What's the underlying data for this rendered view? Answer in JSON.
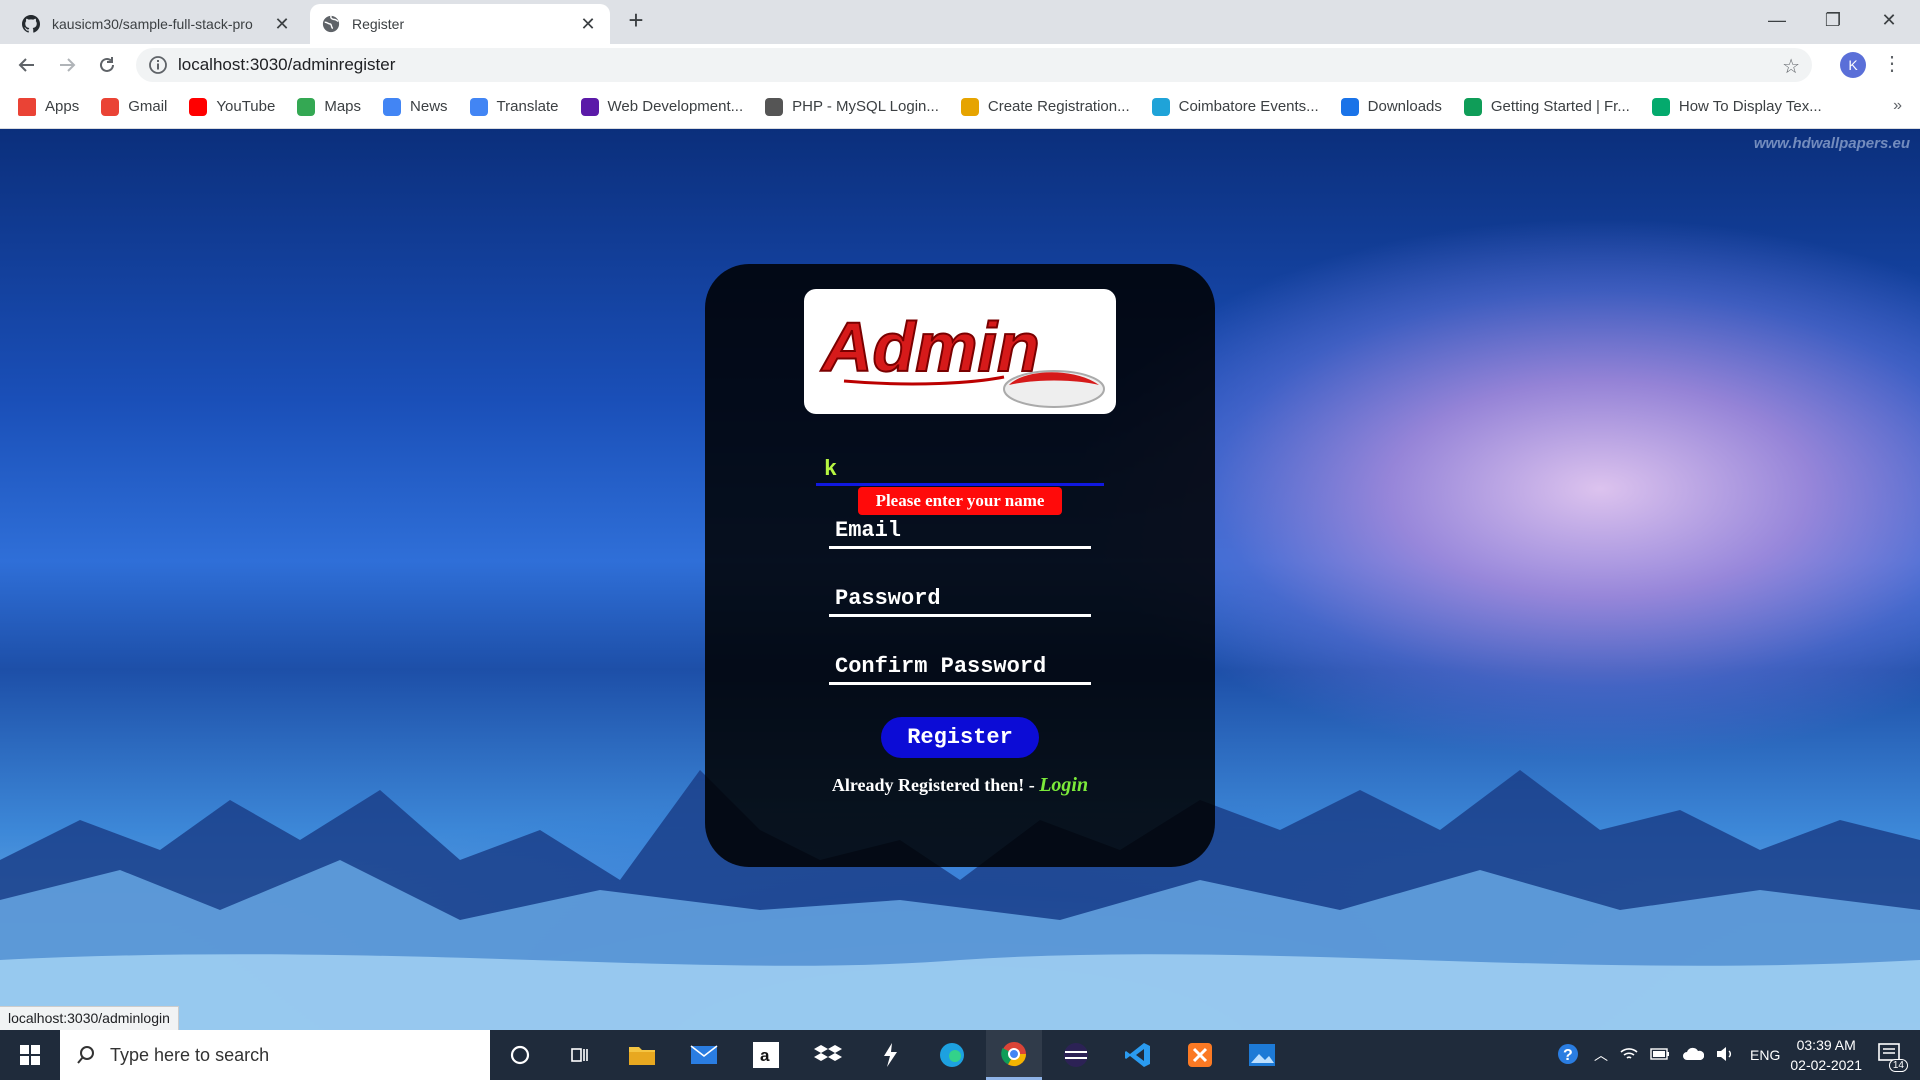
{
  "browser": {
    "tabs": [
      {
        "title": "kausicm30/sample-full-stack-pro",
        "favicon": "github-icon",
        "active": false
      },
      {
        "title": "Register",
        "favicon": "globe-icon",
        "active": true
      }
    ],
    "url_host": "localhost:3030",
    "url_path": "/adminregister",
    "profile_initial": "K"
  },
  "bookmarks": [
    {
      "label": "Apps",
      "icon": "apps-grid-icon",
      "color": "#ea4335"
    },
    {
      "label": "Gmail",
      "icon": "gmail-icon",
      "color": "#ea4335"
    },
    {
      "label": "YouTube",
      "icon": "youtube-icon",
      "color": "#ff0000"
    },
    {
      "label": "Maps",
      "icon": "maps-icon",
      "color": "#34a853"
    },
    {
      "label": "News",
      "icon": "news-icon",
      "color": "#4285f4"
    },
    {
      "label": "Translate",
      "icon": "translate-icon",
      "color": "#4285f4"
    },
    {
      "label": "Web Development...",
      "icon": "phpstorm-icon",
      "color": "#5b1aa8"
    },
    {
      "label": "PHP - MySQL Login...",
      "icon": "diamond-icon",
      "color": "#555555"
    },
    {
      "label": "Create Registration...",
      "icon": "codepen-icon",
      "color": "#e6a400"
    },
    {
      "label": "Coimbatore Events...",
      "icon": "events-icon",
      "color": "#1fa3d8"
    },
    {
      "label": "Downloads",
      "icon": "download-icon",
      "color": "#1a73e8"
    },
    {
      "label": "Getting Started | Fr...",
      "icon": "drive-icon",
      "color": "#0f9d58"
    },
    {
      "label": "How To Display Tex...",
      "icon": "w3schools-icon",
      "color": "#04aa6d"
    }
  ],
  "page": {
    "watermark": "www.hdwallpapers.eu",
    "logo_text": "Admin",
    "name_value": "k",
    "error_text": "Please enter your name",
    "email_placeholder": "Email",
    "password_placeholder": "Password",
    "confirm_placeholder": "Confirm Password",
    "register_label": "Register",
    "already_text": "Already Registered then! - ",
    "login_link": "Login"
  },
  "status_url": "localhost:3030/adminlogin",
  "taskbar": {
    "search_placeholder": "Type here to search",
    "language": "ENG",
    "time": "03:39 AM",
    "date": "02-02-2021",
    "notifications": "14"
  }
}
